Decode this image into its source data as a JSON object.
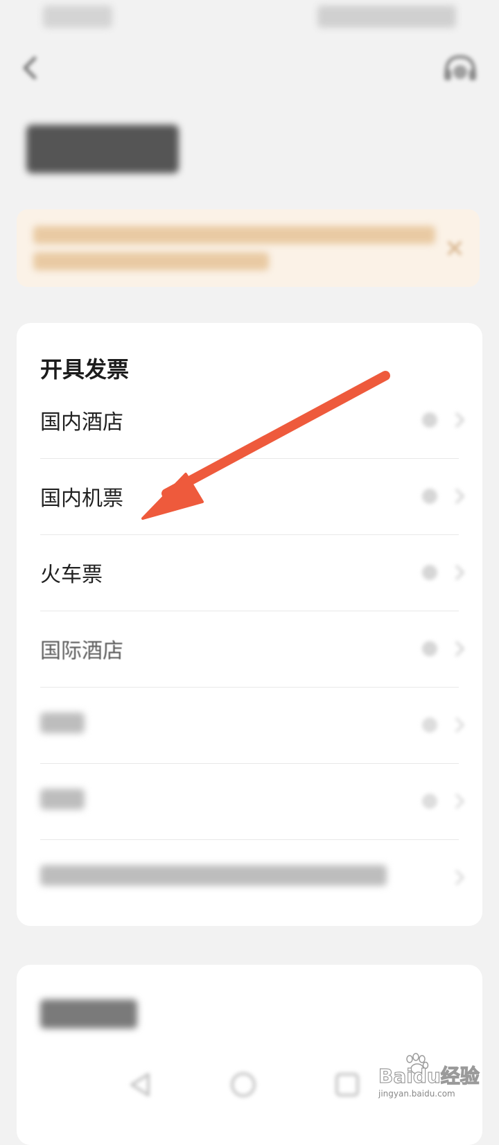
{
  "card": {
    "title": "开具发票",
    "rows": [
      {
        "label": "国内酒店"
      },
      {
        "label": "国内机票"
      },
      {
        "label": "火车票"
      },
      {
        "label": "国际酒店"
      }
    ]
  },
  "watermark": {
    "brand": "Baidu经验",
    "url": "jingyan.baidu.com"
  },
  "colors": {
    "arrow": "#ee5a3c",
    "notice_bg": "#fbf2e7"
  }
}
